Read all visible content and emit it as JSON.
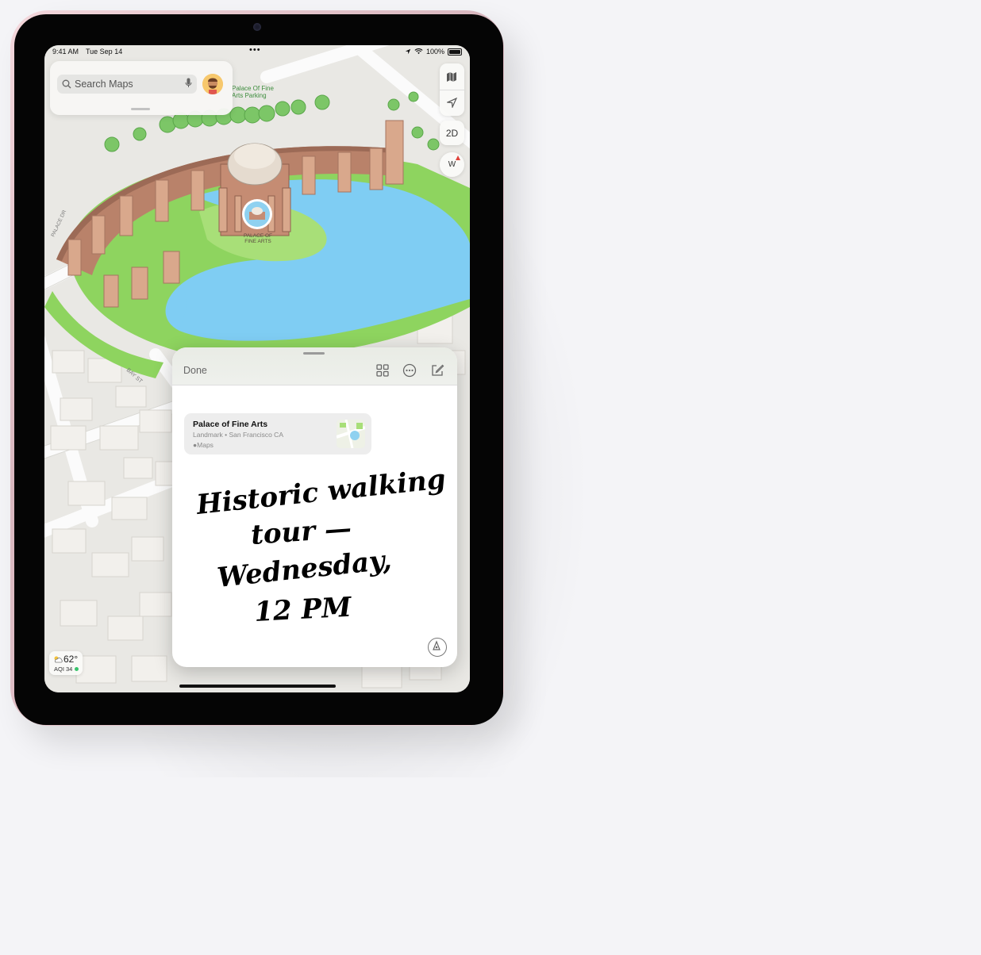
{
  "status_bar": {
    "time": "9:41 AM",
    "date": "Tue Sep 14",
    "battery": "100%"
  },
  "search": {
    "placeholder": "Search Maps"
  },
  "map_labels": {
    "parking": "Palace Of Fine\nArts Parking",
    "landmark": "PALACE OF\nFINE ARTS",
    "palace_dr": "PALACE DR",
    "bay_st": "BAY ST"
  },
  "controls": {
    "view_mode": "2D",
    "compass": "W"
  },
  "weather": {
    "temperature": "62°",
    "aqi": "AQI 34"
  },
  "quick_note": {
    "done_label": "Done",
    "link_card": {
      "title": "Palace of Fine Arts",
      "subtitle": "Landmark • San Francisco CA",
      "source": "Maps"
    },
    "handwriting_lines": [
      "Historic walking",
      "tour —",
      "Wednesday,",
      "12 PM"
    ]
  }
}
